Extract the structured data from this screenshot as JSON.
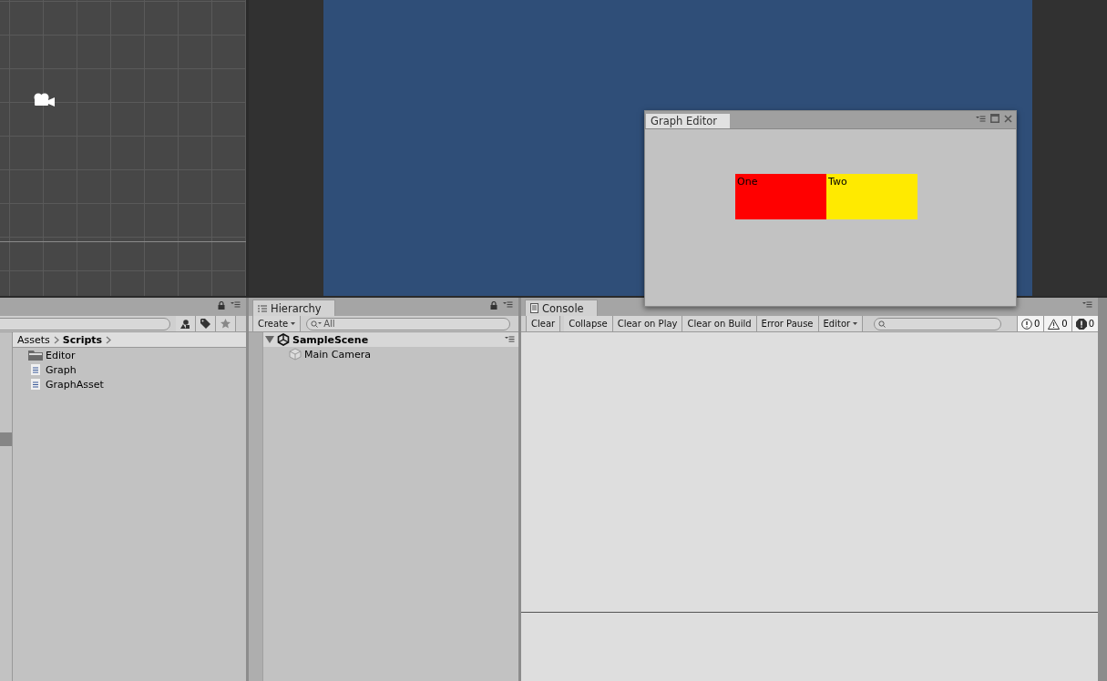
{
  "project": {
    "breadcrumb": [
      {
        "label": "Assets",
        "current": false
      },
      {
        "label": "Scripts",
        "current": true
      }
    ],
    "items": [
      {
        "kind": "folder",
        "label": "Editor"
      },
      {
        "kind": "script",
        "label": "Graph"
      },
      {
        "kind": "script",
        "label": "GraphAsset"
      }
    ]
  },
  "hierarchy": {
    "tab": "Hierarchy",
    "create": "Create",
    "search_placeholder": "All",
    "scene": {
      "name": "SampleScene",
      "expanded": true,
      "children": [
        {
          "label": "Main Camera"
        }
      ]
    }
  },
  "console": {
    "tab": "Console",
    "buttons": [
      {
        "label": "Clear",
        "kind": "button"
      },
      {
        "label": "Collapse",
        "kind": "toggle"
      },
      {
        "label": "Clear on Play",
        "kind": "toggle"
      },
      {
        "label": "Clear on Build",
        "kind": "toggle"
      },
      {
        "label": "Error Pause",
        "kind": "toggle"
      },
      {
        "label": "Editor",
        "kind": "dropdown"
      }
    ],
    "counters": [
      {
        "kind": "info",
        "count": "0"
      },
      {
        "kind": "warning",
        "count": "0"
      },
      {
        "kind": "error",
        "count": "0"
      }
    ]
  },
  "graph_editor": {
    "title": "Graph Editor",
    "nodes": [
      {
        "label": "One",
        "color": "#ff0000"
      },
      {
        "label": "Two",
        "color": "#ffea00"
      }
    ]
  }
}
